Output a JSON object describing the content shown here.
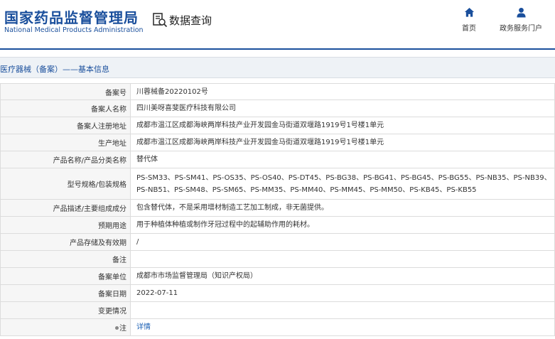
{
  "header": {
    "logo_cn": "国家药品监督管理局",
    "logo_en": "National Medical Products Administration",
    "query_label": "数据查询",
    "nav": [
      {
        "label": "首页",
        "icon": "home-icon"
      },
      {
        "label": "政务服务门户",
        "icon": "user-icon"
      }
    ]
  },
  "colors": {
    "brand": "#1a4f9c",
    "link": "#1a5fb4",
    "label_bg": "#f6f6f6",
    "section_bg": "#eef2f6"
  },
  "section": {
    "title": "医疗器械（备案）——基本信息"
  },
  "rows": [
    {
      "label": "备案号",
      "value": "川蓉械备20220102号"
    },
    {
      "label": "备案人名称",
      "value": "四川美呀喜斐医疗科技有限公司"
    },
    {
      "label": "备案人注册地址",
      "value": "成都市温江区成都海峡两岸科技产业开发园金马街道双堰路1919号1号楼1单元"
    },
    {
      "label": "生产地址",
      "value": "成都市温江区成都海峡两岸科技产业开发园金马街道双堰路1919号1号楼1单元"
    },
    {
      "label": "产品名称/产品分类名称",
      "value": "替代体"
    },
    {
      "label": "型号规格/包装规格",
      "value": "PS-SM33、PS-SM41、PS-OS35、PS-OS40、PS-DT45、PS-BG38、PS-BG41、PS-BG45、PS-BG55、PS-NB35、PS-NB39、PS-NB51、PS-SM48、PS-SM65、PS-MM35、PS-MM40、PS-MM45、PS-MM50、PS-KB45、PS-KB55"
    },
    {
      "label": "产品描述/主要组成成分",
      "value": "包含替代体，不是采用增材制造工艺加工制成，非无菌提供。"
    },
    {
      "label": "预期用途",
      "value": "用于种植体种植或制作牙冠过程中的起辅助作用的耗材。"
    },
    {
      "label": "产品存储及有效期",
      "value": "/"
    },
    {
      "label": "备注",
      "value": ""
    },
    {
      "label": "备案单位",
      "value": "成都市市场监督管理局（知识产权局）"
    },
    {
      "label": "备案日期",
      "value": "2022-07-11"
    },
    {
      "label": "变更情况",
      "value": ""
    },
    {
      "label": "注",
      "value": "详情",
      "icon": "pin-icon"
    }
  ]
}
